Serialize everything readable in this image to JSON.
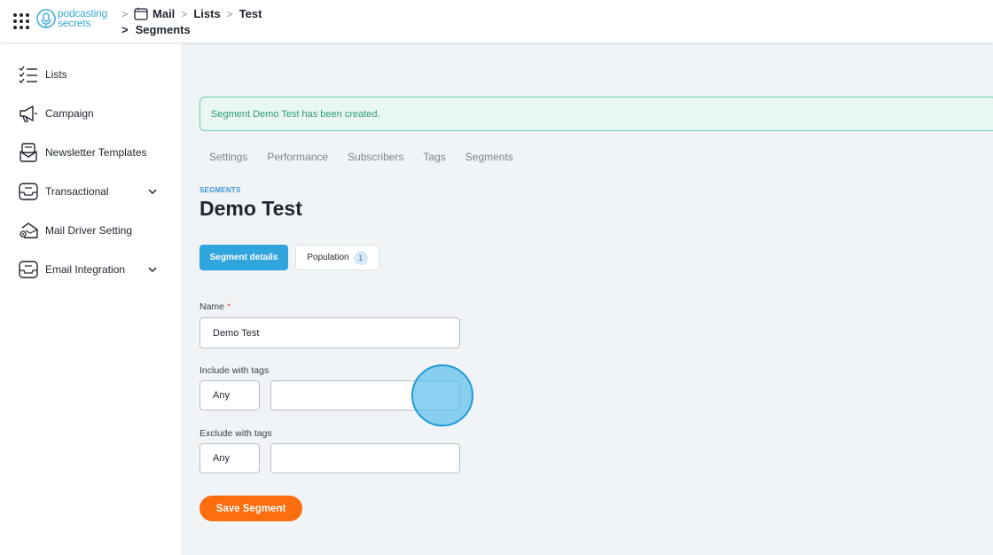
{
  "brand": {
    "logo_line1": "podcasting",
    "logo_line2": "secrets"
  },
  "breadcrumb": {
    "mail": "Mail",
    "lists": "Lists",
    "test": "Test",
    "segments": "Segments",
    "separator": ">"
  },
  "sidebar": {
    "items": [
      {
        "label": "Lists",
        "icon": "list-check-icon"
      },
      {
        "label": "Campaign",
        "icon": "megaphone-icon"
      },
      {
        "label": "Newsletter Templates",
        "icon": "newsletter-icon"
      },
      {
        "label": "Transactional",
        "icon": "inbox-icon",
        "expandable": true
      },
      {
        "label": "Mail Driver Setting",
        "icon": "mail-settings-icon"
      },
      {
        "label": "Email Integration",
        "icon": "inbox-icon",
        "expandable": true
      }
    ]
  },
  "alert": {
    "message": "Segment Demo Test has been created.",
    "color": "#2e9b73"
  },
  "tabs": [
    "Settings",
    "Performance",
    "Subscribers",
    "Tags",
    "Segments"
  ],
  "page": {
    "eyebrow": "SEGMENTS",
    "title": "Demo Test"
  },
  "subtabs": {
    "details": "Segment details",
    "population": "Population",
    "population_count": "1"
  },
  "form": {
    "name_label": "Name",
    "required_mark": "*",
    "name_value": "Demo Test",
    "include_label": "Include with tags",
    "include_mode": "Any",
    "include_value": "",
    "exclude_label": "Exclude with tags",
    "exclude_mode": "Any",
    "exclude_value": ""
  },
  "actions": {
    "save": "Save Segment"
  },
  "colors": {
    "accent": "#2fa4dd",
    "save": "#fb6d0d",
    "alert_bg": "#e9f7f1"
  }
}
